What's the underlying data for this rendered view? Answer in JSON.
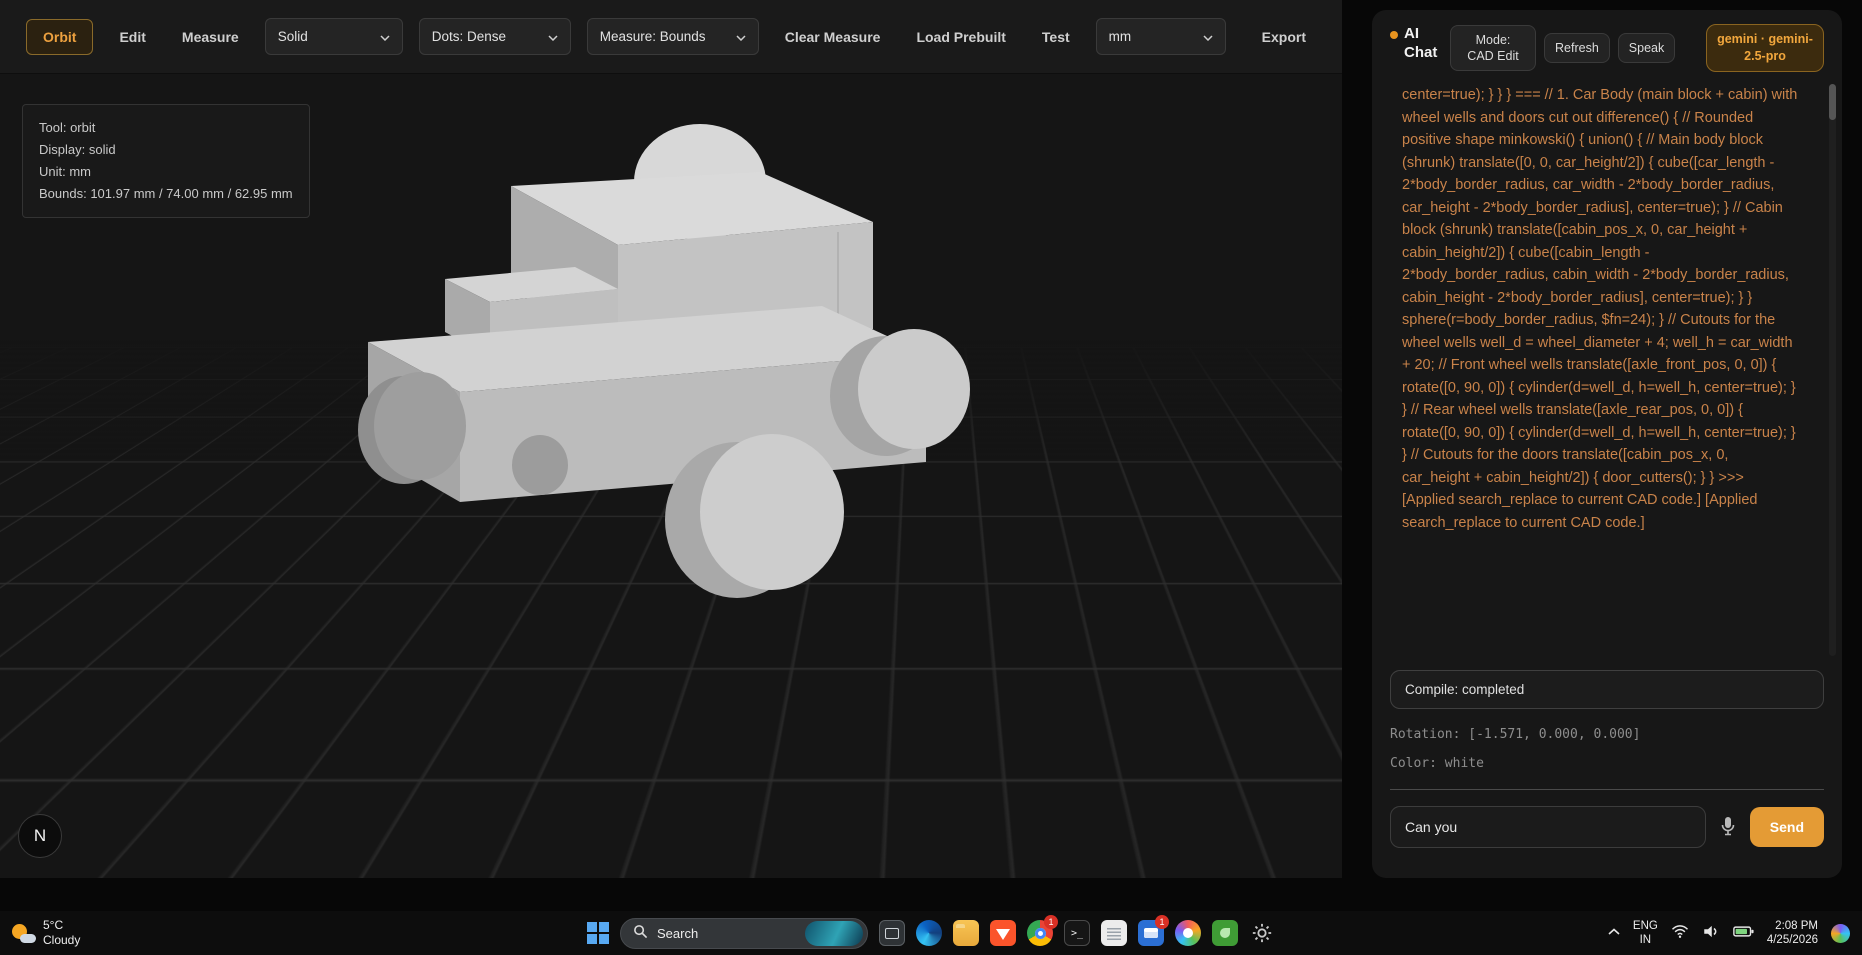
{
  "toolbar": {
    "orbit": "Orbit",
    "edit": "Edit",
    "measure": "Measure",
    "display_select": "Solid",
    "dots_select": "Dots: Dense",
    "measure_select": "Measure: Bounds",
    "clear_measure": "Clear Measure",
    "load_prebuilt": "Load Prebuilt",
    "test": "Test",
    "unit_select": "mm",
    "export": "Export"
  },
  "viewport": {
    "info": {
      "tool": "Tool: orbit",
      "display": "Display: solid",
      "unit": "Unit: mm",
      "bounds": "Bounds: 101.97 mm / 74.00 mm / 62.95 mm"
    },
    "logo": "N"
  },
  "chat": {
    "title": "AI Chat",
    "mode_button": "Mode: CAD Edit",
    "refresh_button": "Refresh",
    "speak_button": "Speak",
    "model_badge": "gemini · gemini-2.5-pro",
    "transcript": "center=true); } } } === // 1. Car Body (main block + cabin) with wheel wells and doors cut out difference() { // Rounded positive shape minkowski() { union() { // Main body block (shrunk) translate([0, 0, car_height/2]) { cube([car_length - 2*body_border_radius, car_width - 2*body_border_radius, car_height - 2*body_border_radius], center=true); } // Cabin block (shrunk) translate([cabin_pos_x, 0, car_height + cabin_height/2]) { cube([cabin_length - 2*body_border_radius, cabin_width - 2*body_border_radius, cabin_height - 2*body_border_radius], center=true); } } sphere(r=body_border_radius, $fn=24); } // Cutouts for the wheel wells well_d = wheel_diameter + 4; well_h = car_width + 20; // Front wheel wells translate([axle_front_pos, 0, 0]) { rotate([0, 90, 0]) { cylinder(d=well_d, h=well_h, center=true); } } // Rear wheel wells translate([axle_rear_pos, 0, 0]) { rotate([0, 90, 0]) { cylinder(d=well_d, h=well_h, center=true); } } // Cutouts for the doors translate([cabin_pos_x, 0, car_height + cabin_height/2]) { door_cutters(); } } >>> [Applied search_replace to current CAD code.] [Applied search_replace to current CAD code.]",
    "compile_status": "Compile: completed",
    "rotation": "Rotation: [-1.571, 0.000, 0.000]",
    "color": "Color: white",
    "input_value": "Can you",
    "send_button": "Send"
  },
  "taskbar": {
    "weather_temp": "5°C",
    "weather_desc": "Cloudy",
    "search_label": "Search",
    "browser_badge": "1",
    "mail_badge": "1",
    "language_line1": "ENG",
    "language_line2": "IN",
    "time": "2:08 PM",
    "date": "4/25/2026"
  },
  "colors": {
    "accent": "#e8a13c",
    "transcript_text": "#c9834a",
    "model_color": "#cdcdcd"
  }
}
